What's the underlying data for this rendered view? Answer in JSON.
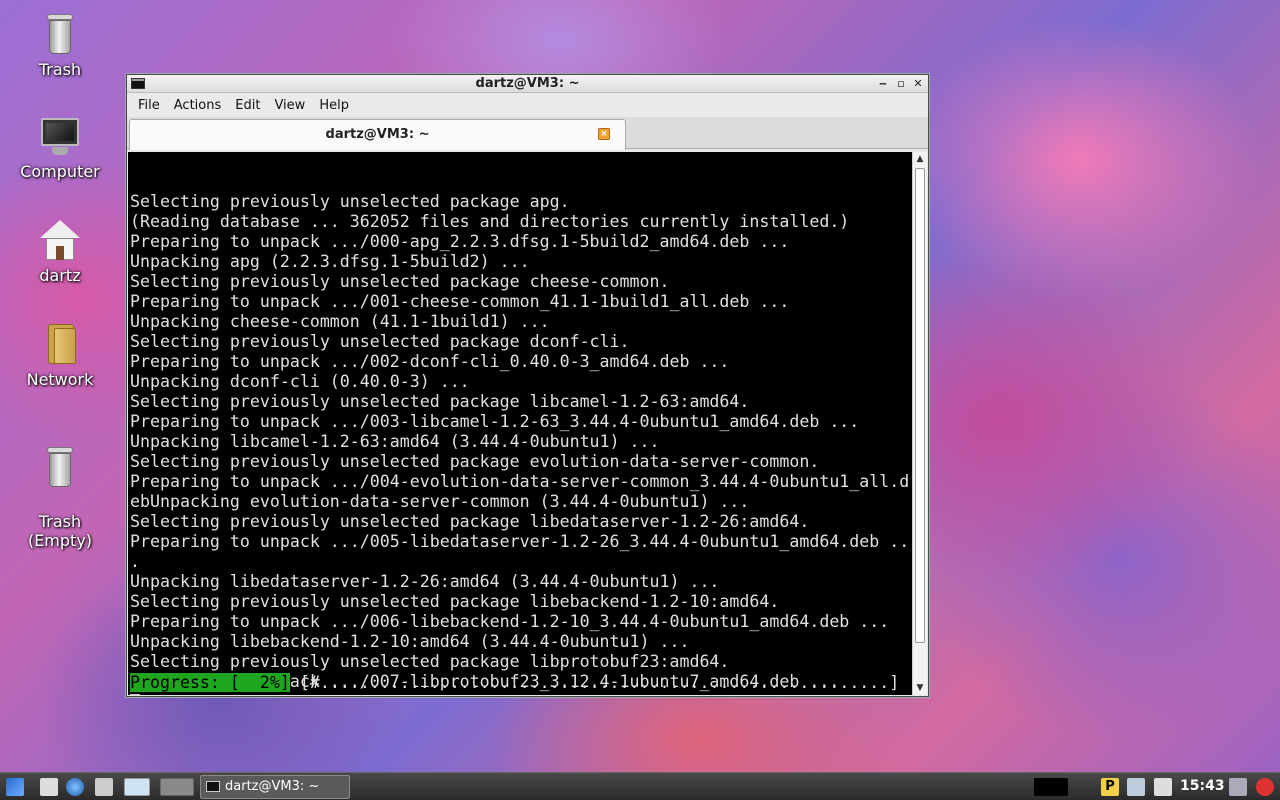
{
  "desktop_icons": [
    {
      "label": "Trash",
      "icon": "trash-icon"
    },
    {
      "label": "Computer",
      "icon": "computer-icon"
    },
    {
      "label": "dartz",
      "icon": "home-folder-icon"
    },
    {
      "label": "Network",
      "icon": "network-folder-icon"
    },
    {
      "label": "Trash\n(Empty)",
      "icon": "trash-empty-icon"
    }
  ],
  "window": {
    "title": "dartz@VM3: ~",
    "controls": {
      "minimize": "‒",
      "maximize": "▫",
      "close": "✕"
    }
  },
  "menu": [
    "File",
    "Actions",
    "Edit",
    "View",
    "Help"
  ],
  "tab": {
    "label": "dartz@VM3: ~"
  },
  "terminal": {
    "lines": [
      "Selecting previously unselected package apg.",
      "(Reading database ... 362052 files and directories currently installed.)",
      "Preparing to unpack .../000-apg_2.2.3.dfsg.1-5build2_amd64.deb ...",
      "Unpacking apg (2.2.3.dfsg.1-5build2) ...",
      "Selecting previously unselected package cheese-common.",
      "Preparing to unpack .../001-cheese-common_41.1-1build1_all.deb ...",
      "Unpacking cheese-common (41.1-1build1) ...",
      "Selecting previously unselected package dconf-cli.",
      "Preparing to unpack .../002-dconf-cli_0.40.0-3_amd64.deb ...",
      "Unpacking dconf-cli (0.40.0-3) ...",
      "Selecting previously unselected package libcamel-1.2-63:amd64.",
      "Preparing to unpack .../003-libcamel-1.2-63_3.44.4-0ubuntu1_amd64.deb ...",
      "Unpacking libcamel-1.2-63:amd64 (3.44.4-0ubuntu1) ...",
      "Selecting previously unselected package evolution-data-server-common.",
      "Preparing to unpack .../004-evolution-data-server-common_3.44.4-0ubuntu1_all.d",
      "ebUnpacking evolution-data-server-common (3.44.4-0ubuntu1) ...",
      "Selecting previously unselected package libedataserver-1.2-26:amd64.",
      "Preparing to unpack .../005-libedataserver-1.2-26_3.44.4-0ubuntu1_amd64.deb ..",
      ".",
      "Unpacking libedataserver-1.2-26:amd64 (3.44.4-0ubuntu1) ...",
      "Selecting previously unselected package libebackend-1.2-10:amd64.",
      "Preparing to unpack .../006-libebackend-1.2-10_3.44.4-0ubuntu1_amd64.deb ...",
      "Unpacking libebackend-1.2-10:amd64 (3.44.4-0ubuntu1) ...",
      "Selecting previously unselected package libprotobuf23:amd64.",
      "Preparing to unpack .../007-libprotobuf23_3.12.4-1ubuntu7_amd64.deb ..."
    ],
    "progress_label": "Progress: [  2%]",
    "progress_bar": " [#.........................................................]"
  },
  "taskbar": {
    "task_label": "dartz@VM3: ~",
    "clock": "15:43",
    "tray_p": "P"
  },
  "colors": {
    "progress_green": "#1fa51f",
    "terminal_bg": "#000000"
  }
}
